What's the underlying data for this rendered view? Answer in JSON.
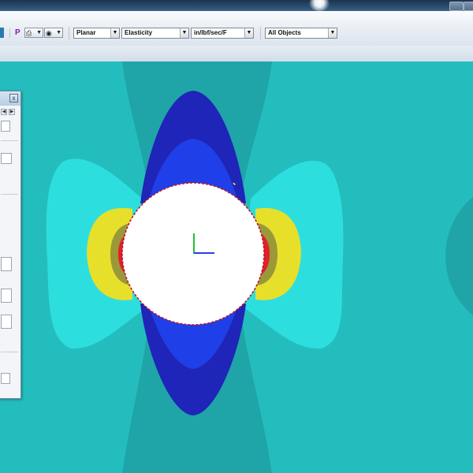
{
  "toolbar": {
    "p_label": "P",
    "analysis_combo": "Planar",
    "material_combo": "Elasticity",
    "units_combo": "in/lbf/sec/F",
    "objects_combo": "All Objects"
  },
  "panel": {
    "close_label": "x"
  },
  "plot": {
    "colors": {
      "background": "#24bdbd",
      "dark_band": "#1fa5a8",
      "light_cyan": "#2ddede",
      "blue": "#1f3fe8",
      "dark_blue": "#1f25b8",
      "yellow": "#e6e02a",
      "olive": "#9a9838",
      "red": "#e0202a",
      "hole": "#ffffff"
    }
  }
}
